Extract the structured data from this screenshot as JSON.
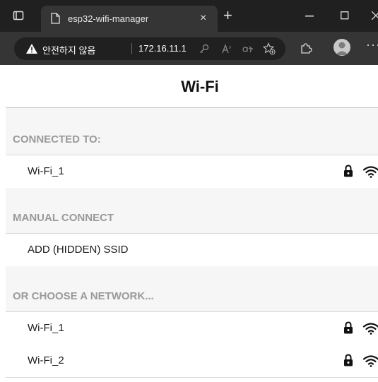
{
  "browser": {
    "tab_title": "esp32-wifi-manager",
    "tab_close": "×",
    "new_tab": "+",
    "security_label": "안전하지 않음",
    "url": "172.16.11.1",
    "more": "···"
  },
  "page": {
    "header_title": "Wi-Fi",
    "connected_section": {
      "title": "CONNECTED TO:",
      "network": {
        "ssid": "Wi-Fi_1",
        "secured": true
      }
    },
    "manual_section": {
      "title": "MANUAL CONNECT",
      "add_label": "ADD (HIDDEN) SSID"
    },
    "choose_section": {
      "title": "OR CHOOSE A NETWORK...",
      "networks": [
        {
          "ssid": "Wi-Fi_1",
          "secured": true
        },
        {
          "ssid": "Wi-Fi_2",
          "secured": true
        }
      ]
    }
  },
  "colors": {
    "section_background": "#f6f6f6",
    "section_title": "#9a9a9a",
    "browser_dark": "#202020"
  }
}
